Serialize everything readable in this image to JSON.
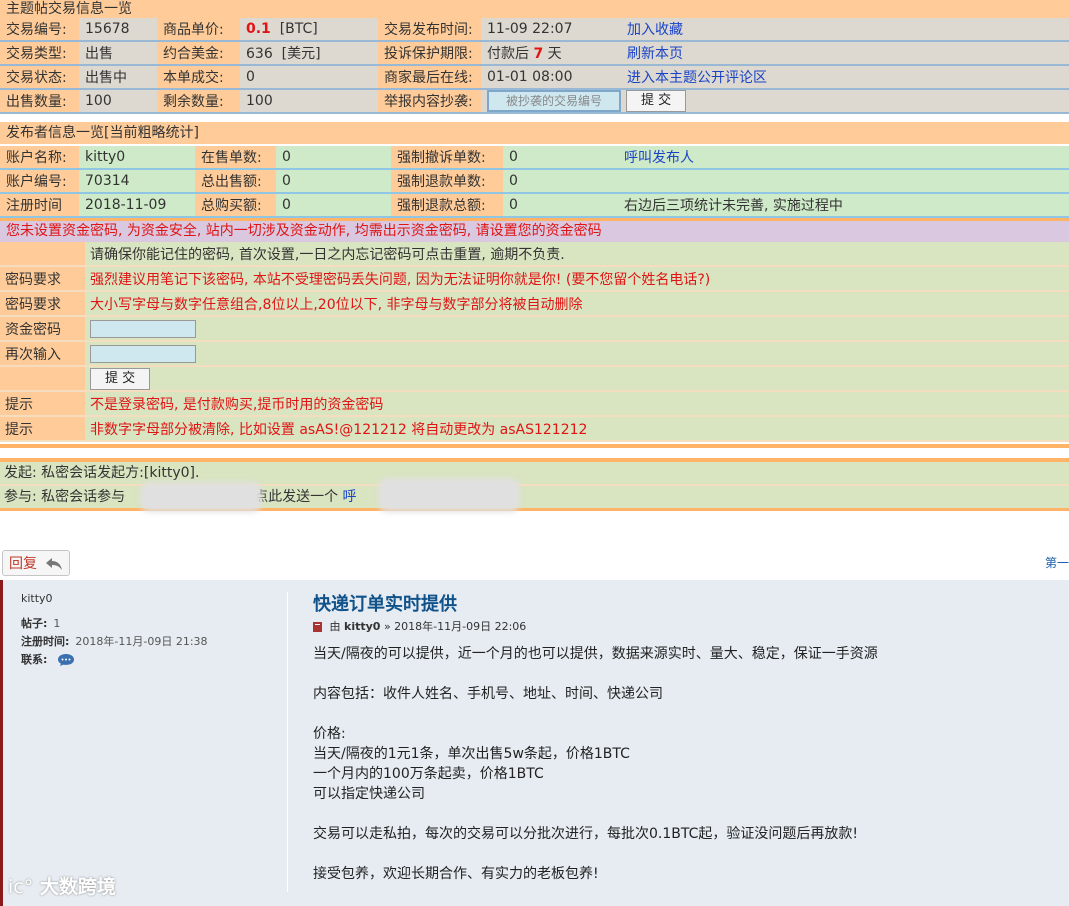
{
  "trade": {
    "header": "主题帖交易信息一览",
    "rows": [
      {
        "l1": "交易编号:",
        "v1": "15678",
        "l2": "商品单价:",
        "v2a": "0.1",
        "v2b": "[BTC]",
        "l3": "交易发布时间:",
        "v3": "11-09 22:07",
        "link": "加入收藏"
      },
      {
        "l1": "交易类型:",
        "v1": "出售",
        "l2": "约合美金:",
        "v2a": "636",
        "v2b": "[美元]",
        "l3": "投诉保护期限:",
        "v3a": "付款后",
        "v3b": "7",
        "v3c": "天",
        "link": "刷新本页"
      },
      {
        "l1": "交易状态:",
        "v1": "出售中",
        "l2": "本单成交:",
        "v2a": "0",
        "l3": "商家最后在线:",
        "v3": "01-01 08:00",
        "link": "进入本主题公开评论区"
      },
      {
        "l1": "出售数量:",
        "v1": "100",
        "l2": "剩余数量:",
        "v2a": "100",
        "l3": "举报内容抄袭:",
        "input_placeholder": "被抄袭的交易编号",
        "submit": "提 交"
      }
    ]
  },
  "publisher": {
    "header": "发布者信息一览[当前粗略统计]",
    "rows": [
      {
        "l1": "账户名称:",
        "v1": "kitty0",
        "l2": "在售单数:",
        "v2": "0",
        "l3": "强制撤诉单数:",
        "v3": "0",
        "extra": "呼叫发布人"
      },
      {
        "l1": "账户编号:",
        "v1": "70314",
        "l2": "总出售额:",
        "v2": "0",
        "l3": "强制退款单数:",
        "v3": "0",
        "extra": ""
      },
      {
        "l1": "注册时间",
        "v1": "2018-11-09",
        "l2": "总购买额:",
        "v2": "0",
        "l3": "强制退款总额:",
        "v3": "0",
        "extra": "右边后三项统计未完善, 实施过程中"
      }
    ]
  },
  "password": {
    "warning": "您未设置资金密码, 为资金安全, 站内一切涉及资金动作, 均需出示资金密码, 请设置您的资金密码",
    "intro": "请确保你能记住的密码, 首次设置,一日之内忘记密码可点击重置, 逾期不负责.",
    "req1_label": "密码要求",
    "req1": "强烈建议用笔记下该密码, 本站不受理密码丢失问题, 因为无法证明你就是你! (要不您留个姓名电话?)",
    "req2_label": "密码要求",
    "req2": "大小写字母与数字任意组合,8位以上,20位以下, 非字母与数字部分将被自动删除",
    "pw_label": "资金密码",
    "pw2_label": "再次输入",
    "submit": "提 交",
    "tip1_label": "提示",
    "tip1": "不是登录密码, 是付款购买,提币时用的资金密码",
    "tip2_label": "提示",
    "tip2": "非数字字母部分被清除, 比如设置 asAS!@121212 将自动更改为 asAS121212"
  },
  "chat": {
    "start_label": "发起:",
    "start_text": "私密会话发起方:[kitty0].",
    "join_label": "参与:",
    "join_text": "私密会话参与",
    "join_mid": "点此发送一个",
    "join_link": "呼"
  },
  "forum": {
    "reply": "回复",
    "pagenav": "第一",
    "author": "kitty0",
    "posts_label": "帖子:",
    "posts_value": "1",
    "reg_label": "注册时间:",
    "reg_value": "2018年-11月-09日 21:38",
    "contact_label": "联系:",
    "title": "快递订单实时提供",
    "meta_by": "由",
    "meta_author": "kitty0",
    "meta_date": "» 2018年-11月-09日 22:06",
    "body": [
      "当天/隔夜的可以提供，近一个月的也可以提供，数据来源实时、量大、稳定，保证一手资源",
      "",
      "内容包括：收件人姓名、手机号、地址、时间、快递公司",
      "",
      "价格:",
      "当天/隔夜的1元1条，单次出售5w条起，价格1BTC",
      "一个月内的100万条起卖，价格1BTC",
      "可以指定快递公司",
      "",
      "交易可以走私拍，每次的交易可以分批次进行，每批次0.1BTC起，验证没问题后再放款!",
      "",
      "接受包养，欢迎长期合作、有实力的老板包养!"
    ],
    "watermark": "大数跨境"
  }
}
